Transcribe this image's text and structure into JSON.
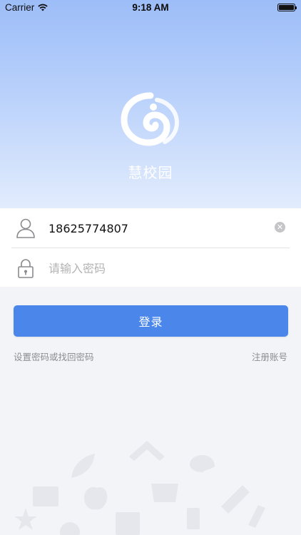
{
  "status_bar": {
    "carrier": "Carrier",
    "time": "9:18 AM"
  },
  "app": {
    "name": "慧校园"
  },
  "form": {
    "phone_value": "18625774807",
    "password_placeholder": "请输入密码"
  },
  "actions": {
    "login_label": "登录",
    "reset_password_label": "设置密码或找回密码",
    "register_label": "注册账号"
  },
  "colors": {
    "accent": "#4b86ea",
    "hero_top": "#9dbdf8",
    "hero_bottom": "#e2ecfd"
  }
}
